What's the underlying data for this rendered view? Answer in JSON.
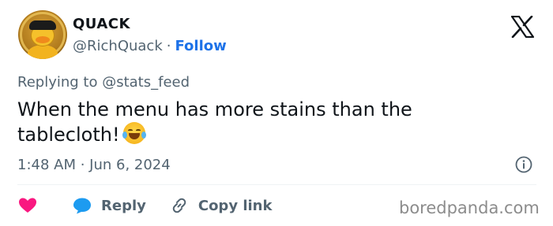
{
  "author": {
    "name": "QUACK",
    "handle": "@RichQuack",
    "separator": "·",
    "follow_label": "Follow"
  },
  "reply_context": {
    "prefix": "Replying to",
    "mention": "@stats_feed"
  },
  "tweet": {
    "text": "When the menu has more stains than the tablecloth!",
    "emoji": "face-with-tears-of-joy"
  },
  "timestamp": "1:48 AM · Jun 6, 2024",
  "actions": {
    "reply_label": "Reply",
    "copy_link_label": "Copy link"
  },
  "watermark": "boredpanda.com",
  "colors": {
    "follow_blue": "#1d72e8",
    "heart_pink": "#f91880",
    "reply_blue": "#1d9bf0",
    "muted_text": "#536471"
  }
}
